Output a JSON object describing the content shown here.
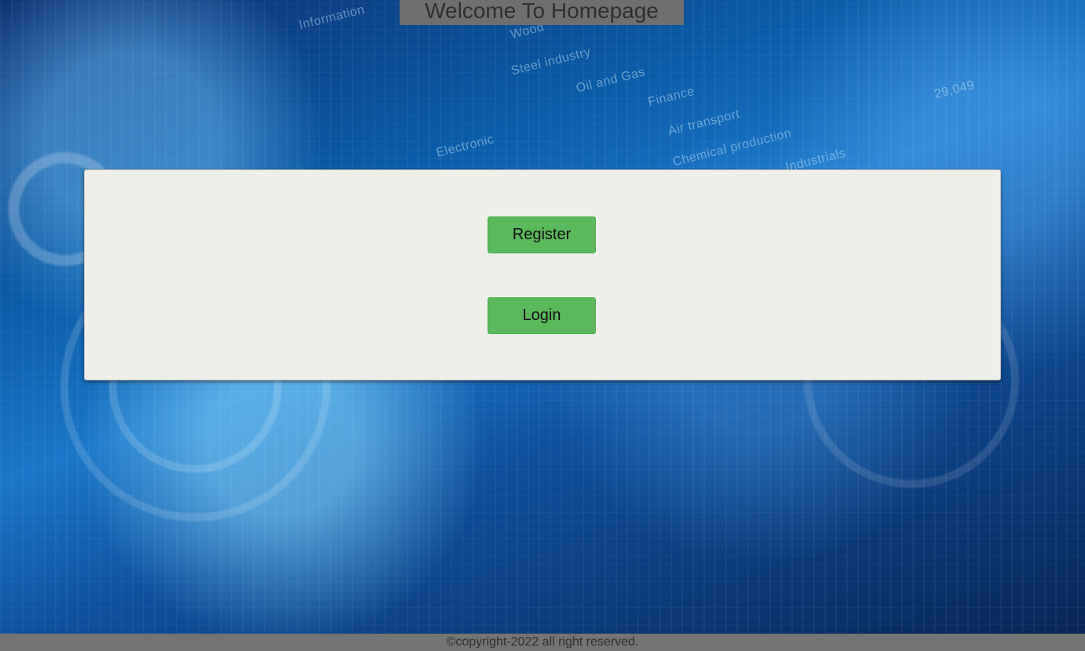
{
  "page": {
    "title": "Welcome To Homepage",
    "register_label": "Register",
    "login_label": "Login",
    "footer_text": "©copyright-2022 all right reserved."
  },
  "background_labels": [
    "Information",
    "Wood",
    "Steel industry",
    "Oil and Gas",
    "Finance",
    "Air transport",
    "Chemical production",
    "Industrials",
    "29,049",
    "Electronic"
  ],
  "colors": {
    "title_bar": "#6f6f6f",
    "panel": "#efefea",
    "button": "#5cb85c",
    "footer": "#747474"
  }
}
